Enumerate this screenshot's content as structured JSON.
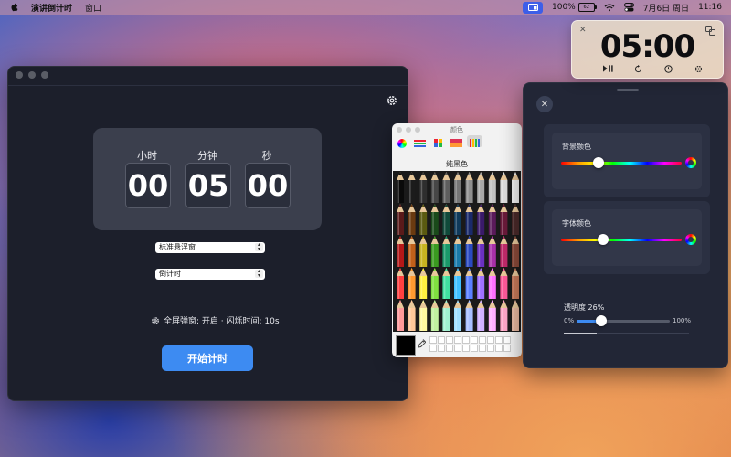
{
  "menubar": {
    "app_name": "演讲倒计时",
    "menus": [
      "窗口"
    ],
    "battery_text": "100%",
    "battery_icon_text": "62",
    "date_time": "7月6日 周日",
    "clock": "11:16"
  },
  "main_window": {
    "timer": {
      "labels": {
        "hours": "小时",
        "minutes": "分钟",
        "seconds": "秒"
      },
      "values": {
        "hours": "00",
        "minutes": "05",
        "seconds": "00"
      }
    },
    "mode_select": {
      "value": "标准悬浮窗"
    },
    "direction_select": {
      "value": "倒计时"
    },
    "info_text": "全屏弹窗: 开启 · 闪烁时间: 10s",
    "start_button": "开始计时"
  },
  "color_panel": {
    "title": "颜色",
    "selected_name": "纯黑色",
    "selected_color": "#000000"
  },
  "settings_panel": {
    "bg_color_label": "背景颜色",
    "bg_hue_fraction": 0.31,
    "font_color_label": "字体颜色",
    "font_hue_fraction": 0.35,
    "opacity_label": "透明度 26%",
    "opacity_fraction": 0.26,
    "opacity_min": "0%",
    "opacity_max": "100%"
  },
  "floating_timer": {
    "time": "05:00"
  },
  "colors": {
    "accent": "#3d8bf2",
    "window_bg": "#1c1f2b",
    "panel_bg": "#222636"
  }
}
